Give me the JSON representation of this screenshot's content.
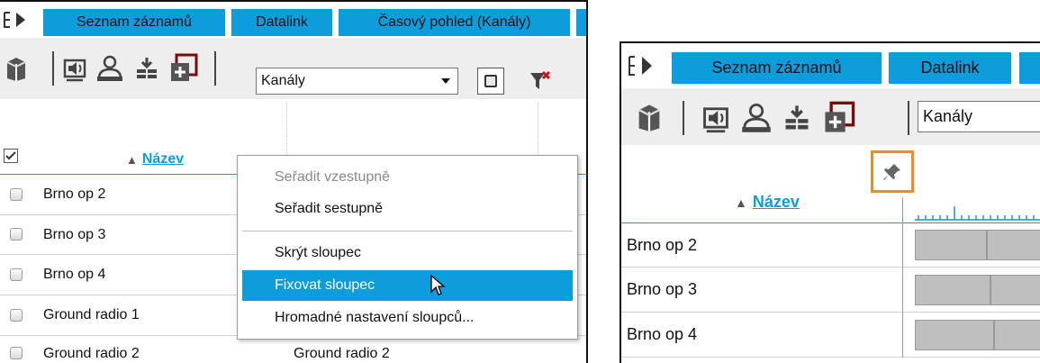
{
  "tabs": {
    "list_label": "Seznam záznamů",
    "datalink_label": "Datalink",
    "timeline_label": "Časový pohled (Kanály)"
  },
  "toolbar": {
    "view_select_value": "Kanály",
    "icons": [
      "packages-icon",
      "speaker-icon",
      "user-icon",
      "tree-download-icon",
      "add-frame-icon",
      "checkbox-icon",
      "clear-filter-icon"
    ]
  },
  "grid": {
    "name_header": "Název",
    "sort_indicator": "▲",
    "second_column_rows": [
      "Ground radio 2"
    ],
    "rows": [
      "Brno op 2",
      "Brno op 3",
      "Brno op 4",
      "Ground radio 1",
      "Ground radio 2"
    ],
    "right_rows": [
      "Brno op 2",
      "Brno op 3",
      "Brno op 4"
    ]
  },
  "context_menu": {
    "sort_asc": "Seřadit vzestupně",
    "sort_desc": "Seřadit sestupně",
    "hide_column": "Skrýt sloupec",
    "pin_column": "Fixovat sloupec",
    "bulk_columns": "Hromadné nastavení sloupců..."
  },
  "colors": {
    "accent": "#0e9ddc",
    "highlight_box": "#f08a24",
    "timeline_bar": "#bfbfbf"
  }
}
